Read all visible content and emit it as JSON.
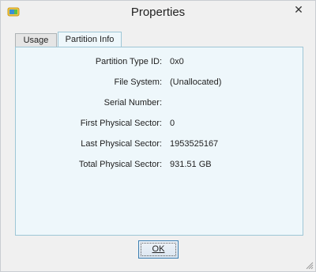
{
  "window": {
    "title": "Properties",
    "close_glyph": "✕"
  },
  "tabs": [
    {
      "label": "Usage"
    },
    {
      "label": "Partition Info"
    }
  ],
  "partition_info": [
    {
      "label": "Partition Type ID:",
      "value": "0x0"
    },
    {
      "label": "File System:",
      "value": "(Unallocated)"
    },
    {
      "label": "Serial Number:",
      "value": ""
    },
    {
      "label": "First Physical Sector:",
      "value": "0"
    },
    {
      "label": "Last Physical Sector:",
      "value": "1953525167"
    },
    {
      "label": "Total Physical Sector:",
      "value": "931.51 GB"
    }
  ],
  "buttons": {
    "ok": "OK"
  },
  "icons": {
    "app": "partition-app-icon",
    "close": "close-icon",
    "resize": "resize-grip-icon"
  }
}
